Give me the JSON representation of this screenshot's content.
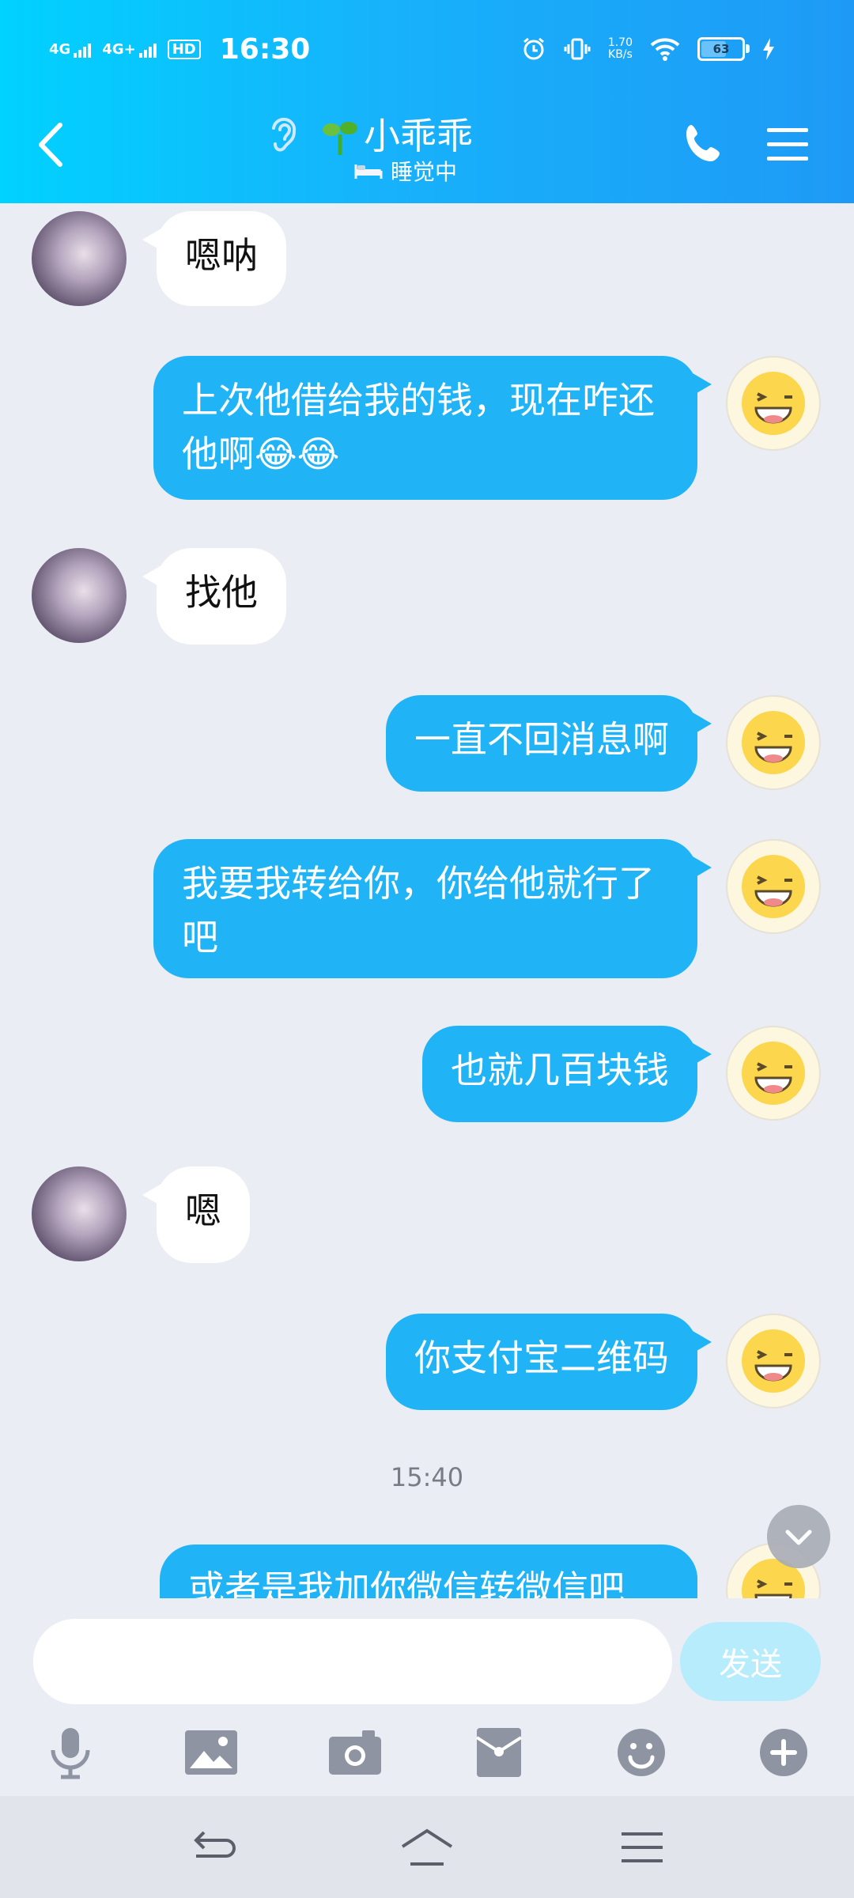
{
  "status_bar": {
    "network1": "4G",
    "network2": "4G+",
    "hd_label": "HD",
    "time": "16:30",
    "speed_value": "1.70",
    "speed_unit": "KB/s",
    "battery": "63"
  },
  "header": {
    "contact_name": "小乖乖",
    "presence": "睡觉中"
  },
  "messages": [
    {
      "side": "in",
      "text": "嗯呐"
    },
    {
      "side": "out",
      "text": "上次他借给我的钱，现在咋还他啊😂😂"
    },
    {
      "side": "in",
      "text": "找他"
    },
    {
      "side": "out",
      "text": "一直不回消息啊"
    },
    {
      "side": "out",
      "text": "我要我转给你，你给他就行了吧"
    },
    {
      "side": "out",
      "text": "也就几百块钱"
    },
    {
      "side": "in",
      "text": "嗯"
    },
    {
      "side": "out",
      "text": "你支付宝二维码"
    },
    {
      "side": "out",
      "text": "或者是我加你微信转微信吧"
    }
  ],
  "timestamp": "15:40",
  "input": {
    "placeholder": "",
    "send_label": "发送"
  },
  "toolbar_icons": [
    "microphone-icon",
    "image-icon",
    "camera-icon",
    "red-packet-icon",
    "emoji-icon",
    "plus-icon"
  ],
  "nav_icons": [
    "back-nav-icon",
    "home-nav-icon",
    "menu-nav-icon"
  ],
  "colors": {
    "header_start": "#00d2ff",
    "header_end": "#1e9af6",
    "outgoing_bubble": "#20b4f7",
    "incoming_bubble": "#ffffff",
    "background": "#eaedf4",
    "send_button": "#b6ecfb"
  }
}
